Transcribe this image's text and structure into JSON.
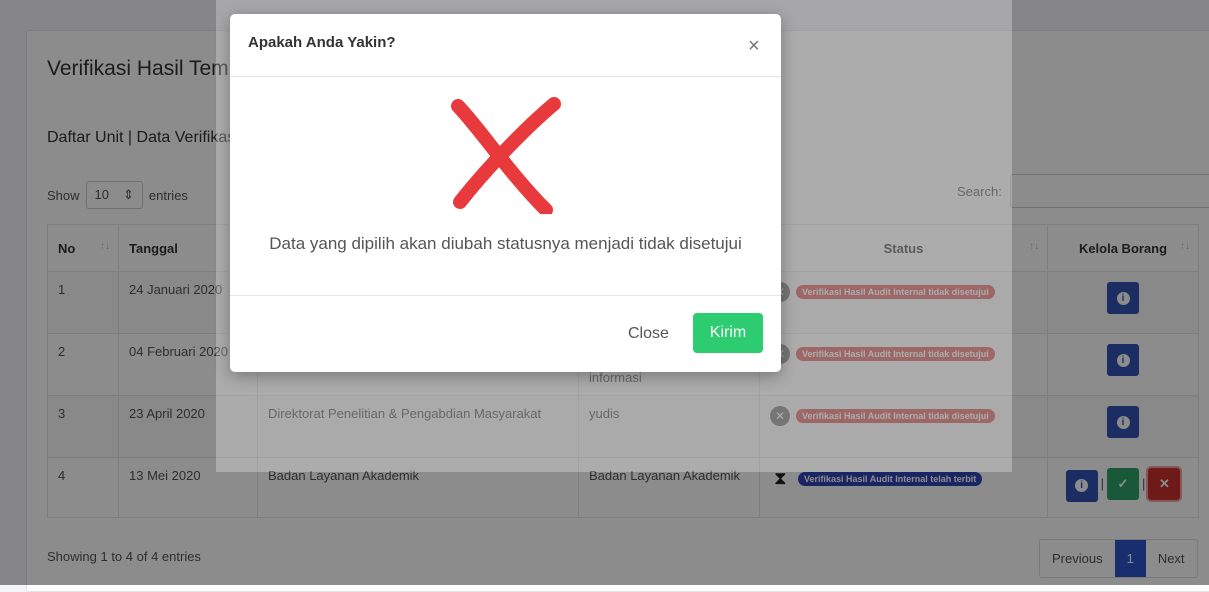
{
  "page": {
    "title": "Verifikasi Hasil Temuan",
    "subtitle": "Daftar Unit | Data Verifikasi",
    "show_label": "Show",
    "show_value": "10",
    "entries_label": "entries",
    "search_label": "Search:"
  },
  "table": {
    "headers": [
      "No",
      "Tanggal",
      "",
      "",
      "Status",
      "Kelola Borang"
    ],
    "rows": [
      {
        "no": "1",
        "date": "24 Januari 2020",
        "unit": "",
        "desc": "",
        "status": "Verifikasi Hasil Audit Internal tidak disetujui"
      },
      {
        "no": "2",
        "date": "04 Februari 2020",
        "unit": "",
        "desc": "informasi",
        "status": "Verifikasi Hasil Audit Internal tidak disetujui"
      },
      {
        "no": "3",
        "date": "23 April 2020",
        "unit": "Direktorat Penelitian & Pengabdian Masyarakat",
        "desc": "yudis",
        "status": "Verifikasi Hasil Audit Internal tidak disetujui"
      },
      {
        "no": "4",
        "date": "13 Mei 2020",
        "unit": "Badan Layanan Akademik",
        "desc": "Badan Layanan Akademik",
        "status": "Verifikasi Hasil Audit Internal telah terbit"
      }
    ]
  },
  "footer": {
    "info": "Showing 1 to 4 of 4 entries",
    "prev": "Previous",
    "page": "1",
    "next": "Next"
  },
  "modal": {
    "title": "Apakah Anda Yakin?",
    "close_symbol": "×",
    "message": "Data yang dipilih akan diubah statusnya menjadi tidak disetujui",
    "close_label": "Close",
    "send_label": "Kirim"
  },
  "colors": {
    "danger": "#d9534f",
    "primary": "#3046b4",
    "success": "#2ecc71",
    "x_mark": "#e8393c"
  }
}
